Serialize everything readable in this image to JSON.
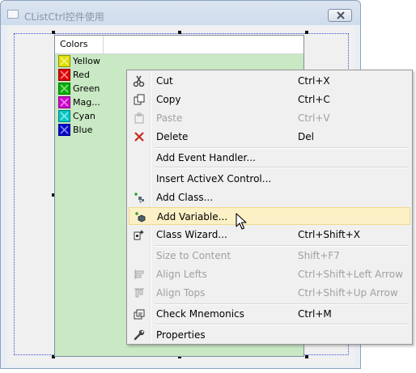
{
  "window": {
    "title": "CListCtrl控件使用"
  },
  "list": {
    "column_header": "Colors",
    "items": [
      {
        "label": "Yellow",
        "color": "#e0e000"
      },
      {
        "label": "Red",
        "color": "#e00000"
      },
      {
        "label": "Green",
        "color": "#00b000"
      },
      {
        "label": "Mag...",
        "color": "#d000d0"
      },
      {
        "label": "Cyan",
        "color": "#00c8c8"
      },
      {
        "label": "Blue",
        "color": "#0000d0"
      }
    ]
  },
  "context_menu": {
    "items": [
      {
        "label": "Cut",
        "shortcut": "Ctrl+X",
        "icon": "scissors-icon",
        "enabled": true
      },
      {
        "label": "Copy",
        "shortcut": "Ctrl+C",
        "icon": "copy-icon",
        "enabled": true
      },
      {
        "label": "Paste",
        "shortcut": "Ctrl+V",
        "icon": "paste-icon",
        "enabled": false
      },
      {
        "label": "Delete",
        "shortcut": "Del",
        "icon": "delete-x-icon",
        "enabled": true
      },
      {
        "label": "Add Event Handler...",
        "shortcut": "",
        "enabled": true
      },
      {
        "label": "Insert ActiveX Control...",
        "shortcut": "",
        "enabled": true
      },
      {
        "label": "Add Class...",
        "shortcut": "",
        "icon": "add-class-icon",
        "enabled": true
      },
      {
        "label": "Add Variable...",
        "shortcut": "",
        "icon": "add-variable-icon",
        "enabled": true,
        "highlighted": true
      },
      {
        "label": "Class Wizard...",
        "shortcut": "Ctrl+Shift+X",
        "icon": "class-wizard-icon",
        "enabled": true
      },
      {
        "label": "Size to Content",
        "shortcut": "Shift+F7",
        "enabled": false
      },
      {
        "label": "Align Lefts",
        "shortcut": "Ctrl+Shift+Left Arrow",
        "icon": "align-lefts-icon",
        "enabled": false
      },
      {
        "label": "Align Tops",
        "shortcut": "Ctrl+Shift+Up Arrow",
        "icon": "align-tops-icon",
        "enabled": false
      },
      {
        "label": "Check Mnemonics",
        "shortcut": "Ctrl+M",
        "icon": "check-mnemonics-icon",
        "enabled": true
      },
      {
        "label": "Properties",
        "shortcut": "",
        "icon": "wrench-icon",
        "enabled": true
      }
    ]
  }
}
